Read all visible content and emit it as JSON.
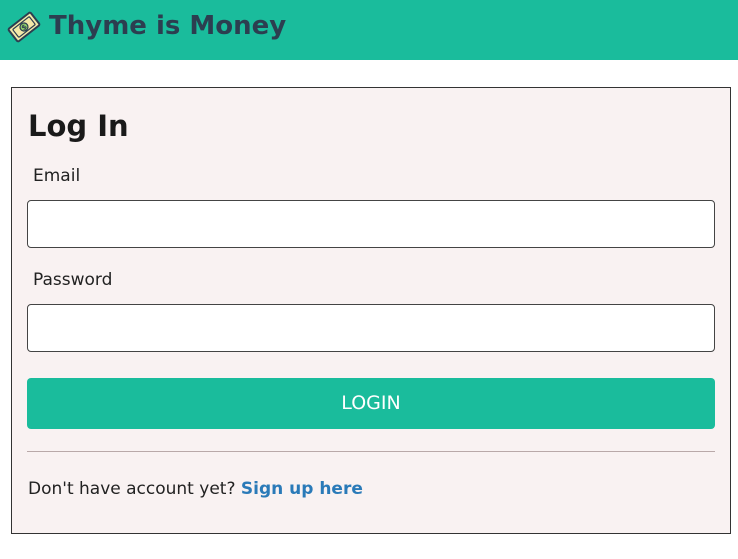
{
  "app": {
    "title": "Thyme is Money",
    "logo_icon": "dollar-bill-icon",
    "brand_color": "#1abc9c",
    "brand_text_color": "#2c3e50"
  },
  "login_form": {
    "title": "Log In",
    "email": {
      "label": "Email",
      "value": "",
      "placeholder": ""
    },
    "password": {
      "label": "Password",
      "value": "",
      "placeholder": ""
    },
    "submit_label": "LOGIN",
    "signup_prompt": "Don't have account yet?",
    "signup_link_label": "Sign up here",
    "link_color": "#2a7ab8"
  }
}
